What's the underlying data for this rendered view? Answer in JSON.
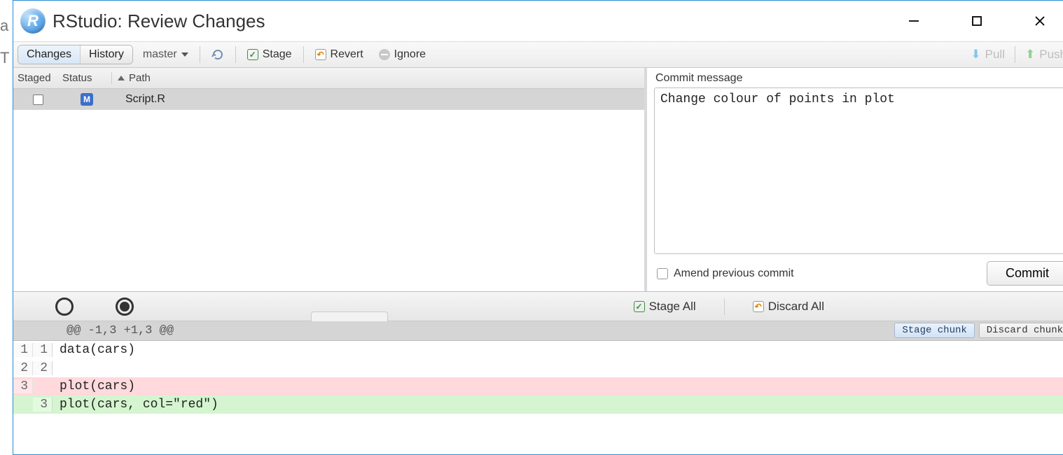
{
  "bg": {
    "a": "a",
    "t": "T"
  },
  "window": {
    "title": "RStudio: Review Changes",
    "app_icon_letter": "R"
  },
  "toolbar": {
    "changes": "Changes",
    "history": "History",
    "branch": "master",
    "stage": "Stage",
    "revert": "Revert",
    "ignore": "Ignore",
    "pull": "Pull",
    "push": "Push"
  },
  "file_list": {
    "headers": {
      "staged": "Staged",
      "status": "Status",
      "path": "Path"
    },
    "rows": [
      {
        "status": "M",
        "path": "Script.R",
        "staged": false
      }
    ]
  },
  "commit": {
    "label": "Commit message",
    "message": "Change colour of points in plot",
    "amend_label": "Amend previous commit",
    "button": "Commit"
  },
  "diff_toolbar": {
    "stage_all": "Stage All",
    "discard_all": "Discard All"
  },
  "hunk": {
    "header": "@@ -1,3 +1,3 @@",
    "stage_chunk": "Stage chunk",
    "discard_chunk": "Discard chunk"
  },
  "diff_lines": [
    {
      "old": "1",
      "new": "1",
      "type": "context",
      "code": "data(cars)"
    },
    {
      "old": "2",
      "new": "2",
      "type": "context",
      "code": ""
    },
    {
      "old": "3",
      "new": "",
      "type": "removed",
      "code": "plot(cars)"
    },
    {
      "old": "",
      "new": "3",
      "type": "added",
      "code": "plot(cars, col=\"red\")"
    }
  ]
}
